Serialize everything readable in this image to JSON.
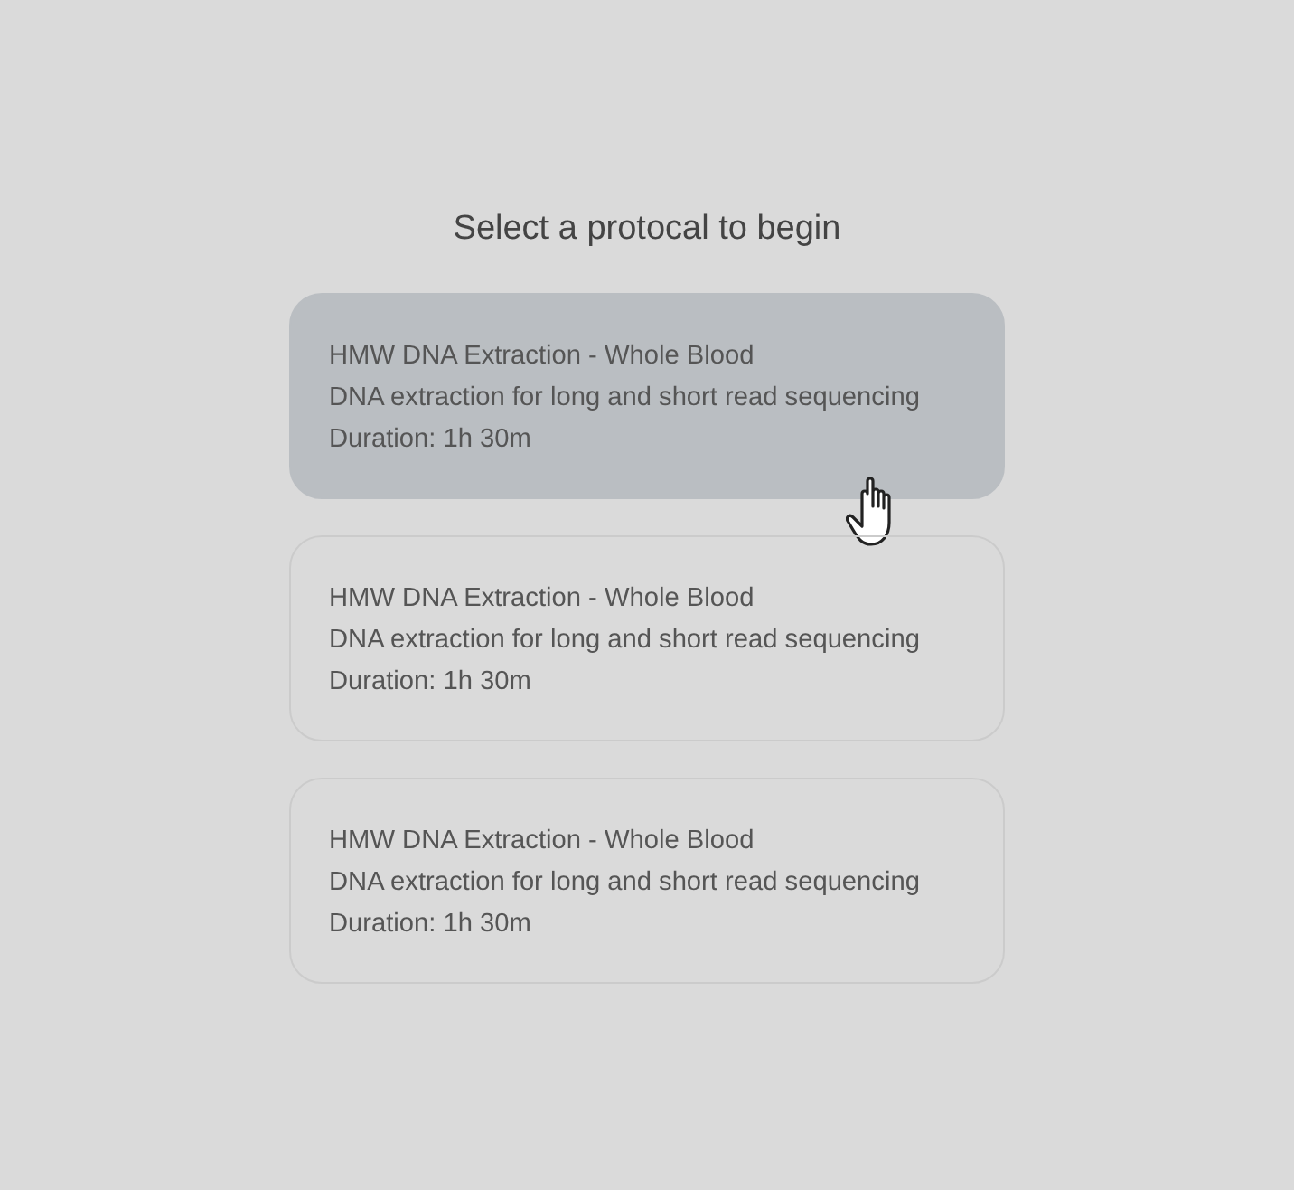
{
  "heading": "Select a protocal to begin",
  "protocols": [
    {
      "title": "HMW DNA Extraction - Whole Blood",
      "description": "DNA extraction for long and short read sequencing",
      "duration": "Duration: 1h 30m",
      "selected": true
    },
    {
      "title": "HMW DNA Extraction - Whole Blood",
      "description": "DNA extraction for long and short read sequencing",
      "duration": "Duration: 1h 30m",
      "selected": false
    },
    {
      "title": "HMW DNA Extraction - Whole Blood",
      "description": "DNA extraction for long and short read sequencing",
      "duration": "Duration: 1h 30m",
      "selected": false
    }
  ]
}
